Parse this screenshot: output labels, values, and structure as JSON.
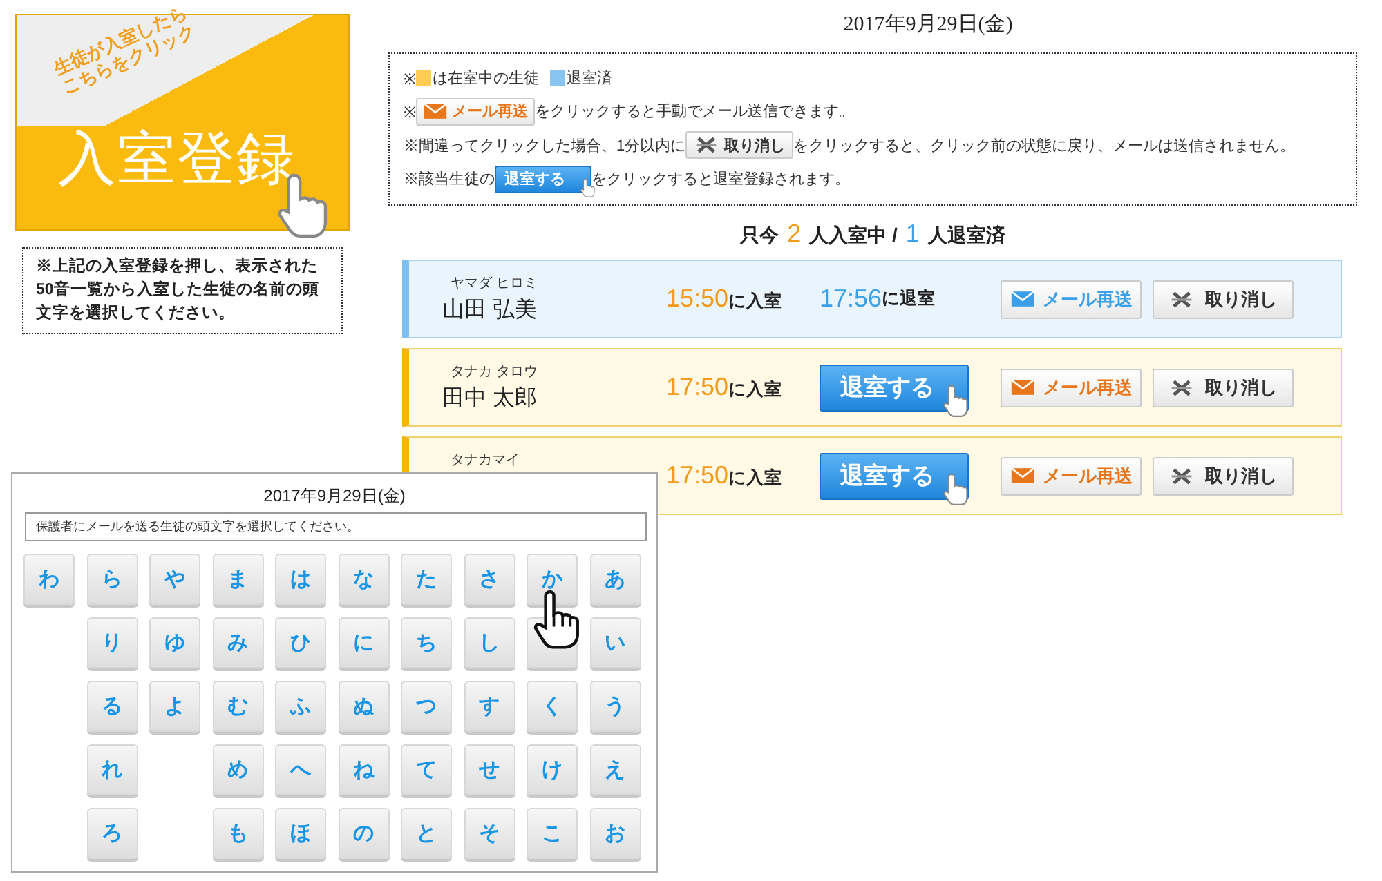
{
  "banner": {
    "tagline_1": "生徒が入室したら",
    "tagline_2": "こちらをクリック",
    "title": "入室登録"
  },
  "note": "※上記の入室登録を押し、表示された50音一覧から入室した生徒の名前の頭文字を選択してください。",
  "date": "2017年9月29日(金)",
  "legend": {
    "mark_1": "※",
    "statuses": [
      {
        "color": "#ffcc55",
        "label": "は在室中の生徒"
      },
      {
        "color": "#88c4f0",
        "label": "退室済"
      }
    ],
    "mark_2": "※",
    "mail_button": "メール再送",
    "mail_text": "をクリックすると手動でメール送信できます。",
    "cancel_lead": "※間違ってクリックした場合、1分以内に",
    "cancel_button": "取り消し",
    "cancel_text": "をクリックすると、クリック前の状態に戻り、メールは送信されません。",
    "exit_lead": "※該当生徒の",
    "exit_button": "退室する",
    "exit_text": "をクリックすると退室登録されます。"
  },
  "summary": {
    "prefix": "只今",
    "in_count": "2",
    "in_label": "人入室中 /",
    "out_count": "1",
    "out_label": "人退室済"
  },
  "students": [
    {
      "kind": "out",
      "kana": "ヤマダ ヒロミ",
      "name": "山田 弘美",
      "in_time": "15:50",
      "in_suffix": "に入室",
      "out_time": "17:56",
      "out_suffix": "に退室",
      "mail_button": "メール再送",
      "cancel_button": "取り消し"
    },
    {
      "kind": "in",
      "kana": "タナカ タロウ",
      "name": "田中 太郎",
      "in_time": "17:50",
      "in_suffix": "に入室",
      "exit_button": "退室する",
      "mail_button": "メール再送",
      "cancel_button": "取り消し"
    },
    {
      "kind": "in",
      "kana": "タナカマイ",
      "in_time": "17:50",
      "in_suffix": "に入室",
      "exit_button": "退室する",
      "mail_button": "メール再送",
      "cancel_button": "取り消し"
    }
  ],
  "kana_picker": {
    "date": "2017年9月29日(金)",
    "instruction": "保護者にメールを送る生徒の頭文字を選択してください。",
    "rows": [
      [
        {
          "kind": "key",
          "label": "わ"
        },
        {
          "kind": "key",
          "label": "ら"
        },
        {
          "kind": "key",
          "label": "や"
        },
        {
          "kind": "key",
          "label": "ま"
        },
        {
          "kind": "key",
          "label": "は"
        },
        {
          "kind": "key",
          "label": "な"
        },
        {
          "kind": "key",
          "label": "た"
        },
        {
          "kind": "key",
          "label": "さ"
        },
        {
          "kind": "key",
          "label": "か"
        },
        {
          "kind": "key",
          "label": "あ"
        }
      ],
      [
        {
          "kind": "gap"
        },
        {
          "kind": "key",
          "label": "り"
        },
        {
          "kind": "key",
          "label": "ゆ"
        },
        {
          "kind": "key",
          "label": "み"
        },
        {
          "kind": "key",
          "label": "ひ"
        },
        {
          "kind": "key",
          "label": "に"
        },
        {
          "kind": "key",
          "label": "ち"
        },
        {
          "kind": "key",
          "label": "し"
        },
        {
          "kind": "covered"
        },
        {
          "kind": "key",
          "label": "い"
        }
      ],
      [
        {
          "kind": "gap"
        },
        {
          "kind": "key",
          "label": "る"
        },
        {
          "kind": "key",
          "label": "よ"
        },
        {
          "kind": "key",
          "label": "む"
        },
        {
          "kind": "key",
          "label": "ふ"
        },
        {
          "kind": "key",
          "label": "ぬ"
        },
        {
          "kind": "key",
          "label": "つ"
        },
        {
          "kind": "key",
          "label": "す"
        },
        {
          "kind": "key",
          "label": "く"
        },
        {
          "kind": "key",
          "label": "う"
        }
      ],
      [
        {
          "kind": "gap"
        },
        {
          "kind": "key",
          "label": "れ"
        },
        {
          "kind": "gap"
        },
        {
          "kind": "key",
          "label": "め"
        },
        {
          "kind": "key",
          "label": "へ"
        },
        {
          "kind": "key",
          "label": "ね"
        },
        {
          "kind": "key",
          "label": "て"
        },
        {
          "kind": "key",
          "label": "せ"
        },
        {
          "kind": "key",
          "label": "け"
        },
        {
          "kind": "key",
          "label": "え"
        }
      ],
      [
        {
          "kind": "gap"
        },
        {
          "kind": "key",
          "label": "ろ"
        },
        {
          "kind": "gap"
        },
        {
          "kind": "key",
          "label": "も"
        },
        {
          "kind": "key",
          "label": "ほ"
        },
        {
          "kind": "key",
          "label": "の"
        },
        {
          "kind": "key",
          "label": "と"
        },
        {
          "kind": "key",
          "label": "そ"
        },
        {
          "kind": "key",
          "label": "こ"
        },
        {
          "kind": "key",
          "label": "お"
        }
      ]
    ]
  }
}
